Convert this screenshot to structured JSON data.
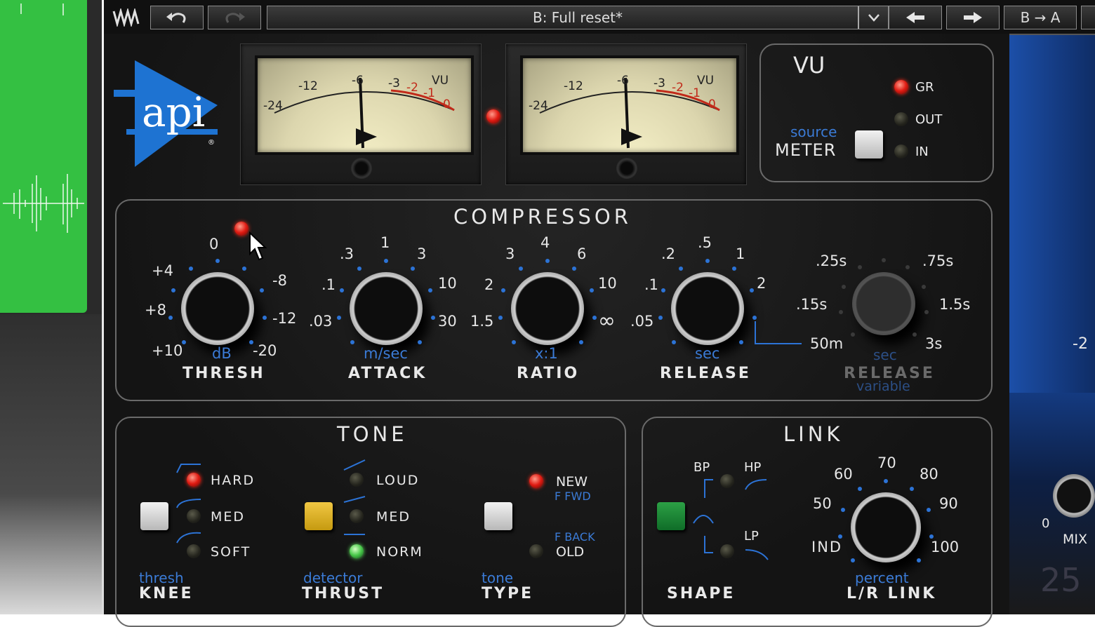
{
  "toolbar": {
    "preset_name": "B: Full reset*",
    "ab_label": "B → A"
  },
  "vu_section": {
    "title": "VU",
    "source_label": "source",
    "meter_label": "METER",
    "options": [
      "GR",
      "OUT",
      "IN"
    ],
    "selected": "GR"
  },
  "meter_scale": [
    "-24",
    "-12",
    "-6",
    "-3",
    "-2",
    "-1",
    "0",
    "VU"
  ],
  "compressor": {
    "title": "COMPRESSOR",
    "knobs": [
      {
        "label": "THRESH",
        "unit": "dB",
        "scale": [
          "0",
          "+4",
          "+8",
          "+10",
          "-8",
          "-12",
          "-20"
        ]
      },
      {
        "label": "ATTACK",
        "unit": "m/sec",
        "scale": [
          ".3",
          "1",
          "3",
          ".1",
          "10",
          ".03",
          "30"
        ]
      },
      {
        "label": "RATIO",
        "unit": "x:1",
        "scale": [
          "3",
          "4",
          "6",
          "2",
          "10",
          "1.5",
          "∞"
        ]
      },
      {
        "label": "RELEASE",
        "unit": "sec",
        "scale": [
          ".2",
          ".5",
          "1",
          ".1",
          "2",
          ".05"
        ]
      },
      {
        "label": "RELEASE",
        "unit": "sec",
        "sublabel": "variable",
        "scale": [
          ".25s",
          ".75s",
          ".15s",
          "1.5s",
          "50m",
          "3s"
        ]
      }
    ]
  },
  "tone": {
    "title": "TONE",
    "knee": {
      "top": "thresh",
      "label": "KNEE",
      "options": [
        "HARD",
        "MED",
        "SOFT"
      ],
      "selected": "HARD"
    },
    "thrust": {
      "top": "detector",
      "label": "THRUST",
      "options": [
        "LOUD",
        "MED",
        "NORM"
      ],
      "selected": "NORM"
    },
    "type": {
      "top": "tone",
      "label": "TYPE",
      "options": [
        "NEW",
        "OLD"
      ],
      "sub_new": "F FWD",
      "sub_old": "F BACK",
      "selected": "NEW"
    }
  },
  "link": {
    "title": "LINK",
    "shape": {
      "label": "SHAPE",
      "options": [
        "BP",
        "HP",
        "LP"
      ]
    },
    "lr_link": {
      "top": "percent",
      "label": "L/R LINK",
      "scale": [
        "70",
        "60",
        "80",
        "50",
        "90",
        "IND",
        "100"
      ]
    }
  },
  "side": {
    "mix_label": "MIX",
    "mix_zero": "0"
  },
  "colors": {
    "accent_blue": "#3b7bd6",
    "led_red": "#e01b12",
    "led_green": "#49c84a",
    "clip_green": "#34c042"
  }
}
